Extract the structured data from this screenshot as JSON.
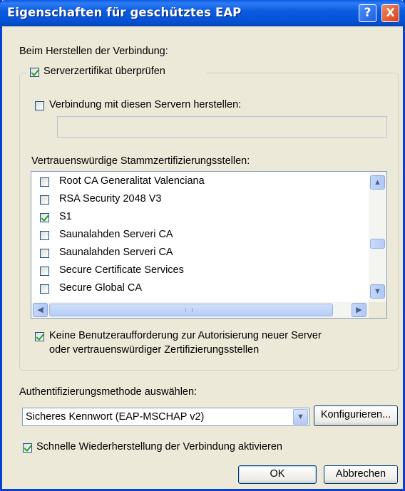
{
  "window": {
    "title": "Eigenschaften für geschütztes EAP",
    "help_glyph": "?",
    "close_glyph": "X"
  },
  "connection": {
    "heading": "Beim Herstellen der Verbindung:",
    "verify_cert": {
      "label": "Serverzertifikat überprüfen",
      "checked": true
    },
    "connect_servers": {
      "label": "Verbindung mit diesen Servern herstellen:",
      "checked": false,
      "value": ""
    },
    "trusted_ca_heading": "Vertrauenswürdige Stammzertifizierungsstellen:",
    "ca_list": [
      {
        "label": "Root CA Generalitat Valenciana",
        "checked": false
      },
      {
        "label": "RSA Security 2048 V3",
        "checked": false
      },
      {
        "label": "S1",
        "checked": true
      },
      {
        "label": "Saunalahden Serveri CA",
        "checked": false
      },
      {
        "label": "Saunalahden Serveri CA",
        "checked": false
      },
      {
        "label": "Secure Certificate Services",
        "checked": false
      },
      {
        "label": "Secure Global CA",
        "checked": false
      }
    ],
    "no_prompt": {
      "line1": "Keine Benutzeraufforderung zur Autorisierung neuer Server",
      "line2": "oder vertrauenswürdiger Zertifizierungsstellen",
      "checked": true
    }
  },
  "auth": {
    "heading": "Authentifizierungsmethode auswählen:",
    "method_value": "Sicheres Kennwort (EAP-MSCHAP v2)",
    "configure_label": "Konfigurieren..."
  },
  "fast_reconnect": {
    "label": "Schnelle Wiederherstellung der Verbindung aktivieren",
    "checked": true
  },
  "footer": {
    "ok_label": "OK",
    "cancel_label": "Abbrechen"
  }
}
